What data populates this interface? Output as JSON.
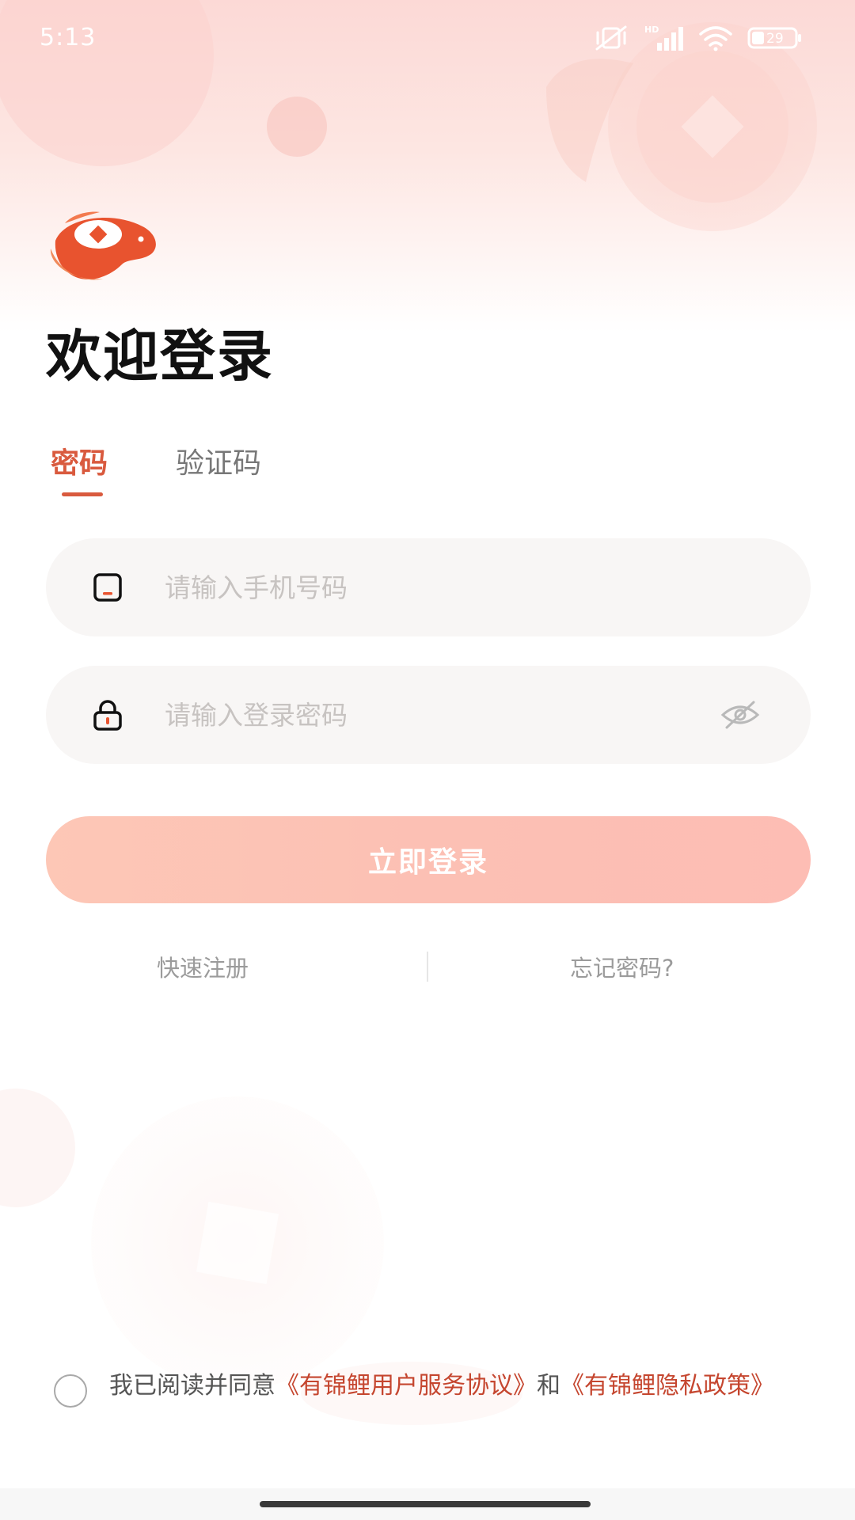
{
  "status_bar": {
    "time": "5:13",
    "network_label": "HD",
    "battery": "29",
    "icons": [
      "vibrate-off-icon",
      "signal-icon",
      "wifi-icon",
      "battery-icon"
    ]
  },
  "logo": {
    "icon": "koi-fish-logo-icon"
  },
  "title": "欢迎登录",
  "tabs": [
    {
      "label": "密码",
      "selected": true
    },
    {
      "label": "验证码",
      "selected": false
    }
  ],
  "form": {
    "phone_placeholder": "请输入手机号码",
    "password_placeholder": "请输入登录密码",
    "phone_icon": "phone-icon",
    "password_icon": "lock-icon",
    "toggle_icon": "eye-closed-icon"
  },
  "login_button": "立即登录",
  "links": {
    "register": "快速注册",
    "forgot": "忘记密码?"
  },
  "agreement": {
    "prefix": "我已阅读并同意",
    "link1": "《有锦鲤用户服务协议》",
    "middle": "和",
    "link2": "《有锦鲤隐私政策》",
    "checked": false
  },
  "colors": {
    "accent": "#d95a3e",
    "link": "#c5462f",
    "button_start": "#fdc7b6",
    "button_end": "#fdbdb4",
    "header_bg": "#fde0dc"
  }
}
